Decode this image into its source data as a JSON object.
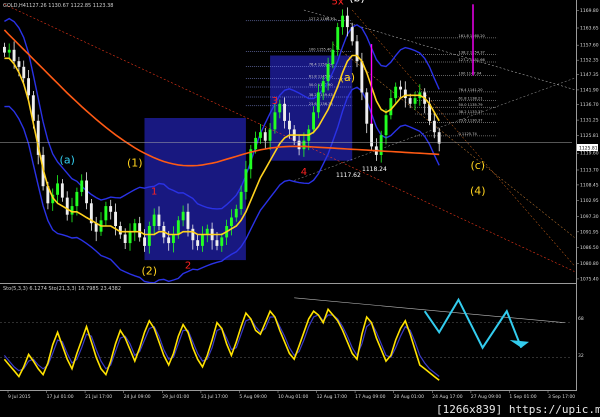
{
  "header": {
    "symbol_label": "GOLD,H4",
    "ohlc": "1127.26 1130.67 1122.85 1123.38",
    "osc_label": "Sto(5,3,3) 6.1274 Sto(21,3,3) 16.7985 23.4382"
  },
  "watermark": "[1266x839] https://upic.me/",
  "price_labels": {
    "low_a": "1117.62",
    "low_b": "1118.24"
  },
  "colors": {
    "background": "#000000",
    "bull": "#22ff22",
    "bear": "#eeeeee",
    "ma_fast": "#ffd21e",
    "ma_slow": "#ff5a14",
    "bands": "#2a32e6",
    "rect": "#1c1c96",
    "magenta": "#ff00ff",
    "cyan": "#33ccee",
    "stoch_main": "#ffe200",
    "stoch_signal": "#3a3ac8"
  },
  "chart_data": {
    "type": "candlestick",
    "symbol": "GOLD",
    "timeframe": "H4",
    "ylim": [
      1075,
      1170
    ],
    "y_ticks": [
      "1169.80",
      "1163.65",
      "1157.60",
      "1152.35",
      "1147.35",
      "1141.90",
      "1136.70",
      "1131.25",
      "1125.81",
      "1119.60",
      "1113.70",
      "1108.45",
      "1102.95",
      "1097.30",
      "1091.95",
      "1086.50",
      "1080.80",
      "1075.40"
    ],
    "x_ticks": [
      "9 Jul 2015",
      "17 Jul 01:00",
      "21 Jul 17:00",
      "24 Jul 09:00",
      "29 Jul 01:00",
      "31 Jul 17:00",
      "5 Aug 09:00",
      "10 Aug 01:00",
      "12 Aug 17:00",
      "17 Aug 09:00",
      "20 Aug 01:00",
      "24 Aug 17:00",
      "27 Aug 09:00",
      "1 Sep 01:00",
      "3 Sep 17:00"
    ],
    "close": [
      1155,
      1156,
      1152,
      1150,
      1146,
      1140,
      1131,
      1119,
      1108,
      1102,
      1105,
      1109,
      1104,
      1098,
      1101,
      1106,
      1110,
      1102,
      1095,
      1092,
      1096,
      1101,
      1099,
      1094,
      1091,
      1088,
      1092,
      1095,
      1090,
      1087,
      1094,
      1098,
      1094,
      1090,
      1088,
      1091,
      1096,
      1099,
      1093,
      1089,
      1087,
      1091,
      1093,
      1089,
      1087,
      1090,
      1094,
      1097,
      1100,
      1106,
      1114,
      1121,
      1125,
      1127,
      1124,
      1128,
      1134,
      1137,
      1131,
      1128,
      1124,
      1121,
      1124,
      1128,
      1134,
      1141,
      1145,
      1151,
      1156,
      1164,
      1168,
      1164,
      1159,
      1152,
      1141,
      1130,
      1122,
      1119,
      1126,
      1133,
      1139,
      1143,
      1142,
      1139,
      1137,
      1139,
      1141,
      1137,
      1131,
      1127,
      1123
    ],
    "open": [
      1157,
      1155,
      1156,
      1152,
      1150,
      1146,
      1140,
      1131,
      1119,
      1108,
      1102,
      1105,
      1109,
      1104,
      1098,
      1101,
      1106,
      1110,
      1102,
      1095,
      1092,
      1096,
      1101,
      1099,
      1094,
      1091,
      1088,
      1092,
      1095,
      1090,
      1087,
      1094,
      1098,
      1094,
      1090,
      1088,
      1091,
      1096,
      1099,
      1093,
      1089,
      1087,
      1091,
      1093,
      1089,
      1087,
      1090,
      1094,
      1097,
      1100,
      1106,
      1114,
      1121,
      1125,
      1127,
      1124,
      1128,
      1134,
      1137,
      1131,
      1128,
      1124,
      1121,
      1124,
      1128,
      1134,
      1141,
      1145,
      1151,
      1156,
      1164,
      1168,
      1164,
      1159,
      1152,
      1141,
      1130,
      1122,
      1119,
      1126,
      1133,
      1139,
      1143,
      1142,
      1139,
      1137,
      1139,
      1141,
      1137,
      1131,
      1127
    ],
    "ma_fast": [
      1153,
      1153,
      1151,
      1148,
      1144,
      1138,
      1130,
      1122,
      1114,
      1108,
      1104,
      1102,
      1101,
      1100,
      1099,
      1099,
      1098,
      1097,
      1096,
      1095,
      1094,
      1094,
      1094,
      1093,
      1092,
      1092,
      1092,
      1092,
      1092,
      1091,
      1091,
      1091,
      1092,
      1092,
      1091,
      1091,
      1091,
      1092,
      1092,
      1092,
      1091,
      1091,
      1091,
      1091,
      1091,
      1091,
      1092,
      1093,
      1094,
      1096,
      1099,
      1103,
      1107,
      1111,
      1114,
      1117,
      1120,
      1123,
      1125,
      1126,
      1126,
      1126,
      1126,
      1126,
      1127,
      1129,
      1132,
      1135,
      1139,
      1143,
      1148,
      1152,
      1154,
      1154,
      1152,
      1148,
      1143,
      1138,
      1135,
      1134,
      1135,
      1137,
      1139,
      1140,
      1140,
      1140,
      1140,
      1139,
      1137,
      1134,
      1131
    ],
    "ma_slow": [
      1163.0,
      1161.2,
      1159.5,
      1157.8,
      1156.1,
      1154.4,
      1152.7,
      1151.0,
      1149.3,
      1147.6,
      1145.9,
      1144.2,
      1142.5,
      1140.8,
      1139.2,
      1137.6,
      1136.0,
      1134.5,
      1133.0,
      1131.5,
      1130.1,
      1128.7,
      1127.4,
      1126.1,
      1124.9,
      1123.7,
      1122.6,
      1121.5,
      1120.5,
      1119.6,
      1118.8,
      1118.0,
      1117.3,
      1116.7,
      1116.2,
      1115.8,
      1115.5,
      1115.3,
      1115.2,
      1115.2,
      1115.3,
      1115.5,
      1115.8,
      1116.1,
      1116.5,
      1117.0,
      1117.5,
      1118.0,
      1118.5,
      1119.0,
      1119.5,
      1120.0,
      1120.4,
      1120.8,
      1121.1,
      1121.4,
      1121.6,
      1121.8,
      1121.9,
      1122.0,
      1122.0,
      1122.0,
      1122.0,
      1121.9,
      1121.8,
      1121.7,
      1121.6,
      1121.5,
      1121.4,
      1121.3,
      1121.2,
      1121.1,
      1121.0,
      1120.9,
      1120.8,
      1120.7,
      1120.6,
      1120.5,
      1120.4,
      1120.3,
      1120.2,
      1120.1,
      1120.0,
      1119.9,
      1119.8,
      1119.7,
      1119.6,
      1119.5,
      1119.4,
      1119.3,
      1119.2
    ],
    "fib_levels": [
      {
        "label": "161.8 1160.20",
        "value": 1160.2
      },
      {
        "label": "138.2 1154.37",
        "value": 1154.4
      },
      {
        "label": "127.2 1151.66",
        "value": 1151.7
      },
      {
        "label": "100 1147.04",
        "value": 1147.0
      },
      {
        "label": "76.4 1141.20",
        "value": 1141.2
      },
      {
        "label": "61.8 1138.21",
        "value": 1138.2
      },
      {
        "label": "50.0 1135.79",
        "value": 1135.8
      },
      {
        "label": "38.2 1133.37",
        "value": 1133.4
      },
      {
        "label": "23.6 1130.37",
        "value": 1130.4
      },
      {
        "label": "0 1125.74",
        "value": 1125.7
      }
    ],
    "fib_levels_left": [
      {
        "label": "127.2 1166.23",
        "value": 1166.2
      },
      {
        "label": "100 1155.40",
        "value": 1155.4
      },
      {
        "label": "76.4 1150.14",
        "value": 1150.1
      },
      {
        "label": "61.8 1145.85",
        "value": 1145.9
      },
      {
        "label": "50.0 1142.90",
        "value": 1142.9
      },
      {
        "label": "38.2 1139.43",
        "value": 1139.4
      },
      {
        "label": "23.6 1136.33",
        "value": 1136.3
      }
    ],
    "wave_labels": [
      {
        "text": "(a)",
        "color": "#33ccee",
        "i": 13,
        "price": 1116
      },
      {
        "text": "(1)",
        "color": "#ffd21e",
        "i": 27,
        "price": 1115
      },
      {
        "text": "1",
        "color": "#ff2222",
        "i": 31,
        "price": 1105
      },
      {
        "text": "(2)",
        "color": "#ffd21e",
        "i": 30,
        "price": 1077
      },
      {
        "text": "2",
        "color": "#ff2222",
        "i": 38,
        "price": 1079
      },
      {
        "text": "3",
        "color": "#ff2222",
        "i": 56,
        "price": 1137
      },
      {
        "text": "4",
        "color": "#ff2222",
        "i": 62,
        "price": 1112
      },
      {
        "text": "(a)",
        "color": "#ffd21e",
        "i": 71,
        "price": 1145
      },
      {
        "text": "5x",
        "color": "#ff2222",
        "i": 69,
        "price": 1172
      },
      {
        "text": "(b)",
        "color": "#ffffff",
        "i": 73,
        "price": 1173
      },
      {
        "text": "(c)",
        "color": "#ffd21e",
        "i": 98,
        "price": 1114
      },
      {
        "text": "(4)",
        "color": "#ffd21e",
        "i": 98,
        "price": 1105
      }
    ],
    "stochastic": {
      "main": [
        30,
        24,
        18,
        12,
        22,
        35,
        28,
        20,
        14,
        26,
        45,
        58,
        44,
        30,
        20,
        36,
        50,
        64,
        48,
        32,
        20,
        14,
        28,
        46,
        60,
        52,
        40,
        28,
        42,
        58,
        70,
        62,
        48,
        34,
        24,
        36,
        54,
        66,
        58,
        42,
        30,
        22,
        34,
        50,
        68,
        62,
        46,
        34,
        48,
        64,
        78,
        72,
        60,
        56,
        68,
        80,
        74,
        60,
        48,
        36,
        30,
        44,
        58,
        72,
        80,
        76,
        68,
        82,
        76,
        70,
        60,
        48,
        36,
        30,
        56,
        74,
        68,
        52,
        40,
        28,
        34,
        50,
        62,
        70,
        56,
        40,
        24,
        20,
        16,
        12,
        8
      ],
      "signal": [
        34,
        28,
        22,
        18,
        20,
        28,
        30,
        24,
        20,
        24,
        36,
        50,
        48,
        36,
        26,
        30,
        42,
        56,
        54,
        40,
        28,
        20,
        24,
        38,
        52,
        54,
        46,
        34,
        38,
        50,
        62,
        64,
        54,
        40,
        30,
        32,
        46,
        60,
        60,
        48,
        36,
        28,
        30,
        42,
        60,
        62,
        52,
        40,
        42,
        56,
        70,
        72,
        64,
        58,
        62,
        74,
        74,
        64,
        54,
        42,
        34,
        38,
        50,
        64,
        74,
        76,
        70,
        76,
        76,
        72,
        64,
        54,
        42,
        34,
        46,
        64,
        68,
        58,
        46,
        34,
        32,
        42,
        54,
        64,
        60,
        48,
        34,
        26,
        20,
        16,
        12
      ],
      "ylim": [
        0,
        100
      ],
      "y_ticks": [
        "68",
        "32"
      ]
    }
  }
}
